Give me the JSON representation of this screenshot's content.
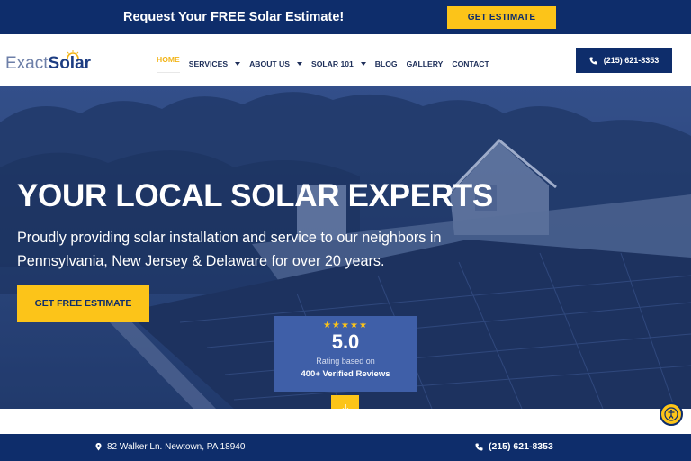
{
  "promo": {
    "text": "Request Your FREE Solar Estimate!",
    "button": "GET ESTIMATE"
  },
  "header": {
    "logo_left": "Exact",
    "logo_right": "Solar",
    "nav": [
      {
        "label": "HOME",
        "active": true,
        "dropdown": false
      },
      {
        "label": "SERVICES",
        "active": false,
        "dropdown": true
      },
      {
        "label": "ABOUT US",
        "active": false,
        "dropdown": true
      },
      {
        "label": "SOLAR 101",
        "active": false,
        "dropdown": true
      },
      {
        "label": "BLOG",
        "active": false,
        "dropdown": false
      },
      {
        "label": "GALLERY",
        "active": false,
        "dropdown": false
      },
      {
        "label": "CONTACT",
        "active": false,
        "dropdown": false
      }
    ],
    "phone": "(215) 621-8353"
  },
  "hero": {
    "title": "YOUR LOCAL SOLAR EXPERTS",
    "subtitle": "Proudly providing solar installation and service to our neighbors in Pennsylvania, New Jersey & Delaware for over 20 years.",
    "cta": "GET FREE ESTIMATE"
  },
  "review": {
    "stars": "★★★★★",
    "score": "5.0",
    "label": "Rating based on",
    "count": "400+ Verified Reviews"
  },
  "footer": {
    "address": "82 Walker Ln. Newtown, PA 18940",
    "phone": "(215) 621-8353"
  },
  "colors": {
    "navy": "#0e2d6b",
    "yellow": "#fcc419",
    "hero_overlay": "#27416f",
    "review_box": "#3f5fa8"
  },
  "icons": [
    "phone-icon",
    "sun-icon",
    "chevron-down-icon",
    "arrow-down-icon",
    "accessibility-icon",
    "location-pin-icon",
    "star-icon"
  ]
}
